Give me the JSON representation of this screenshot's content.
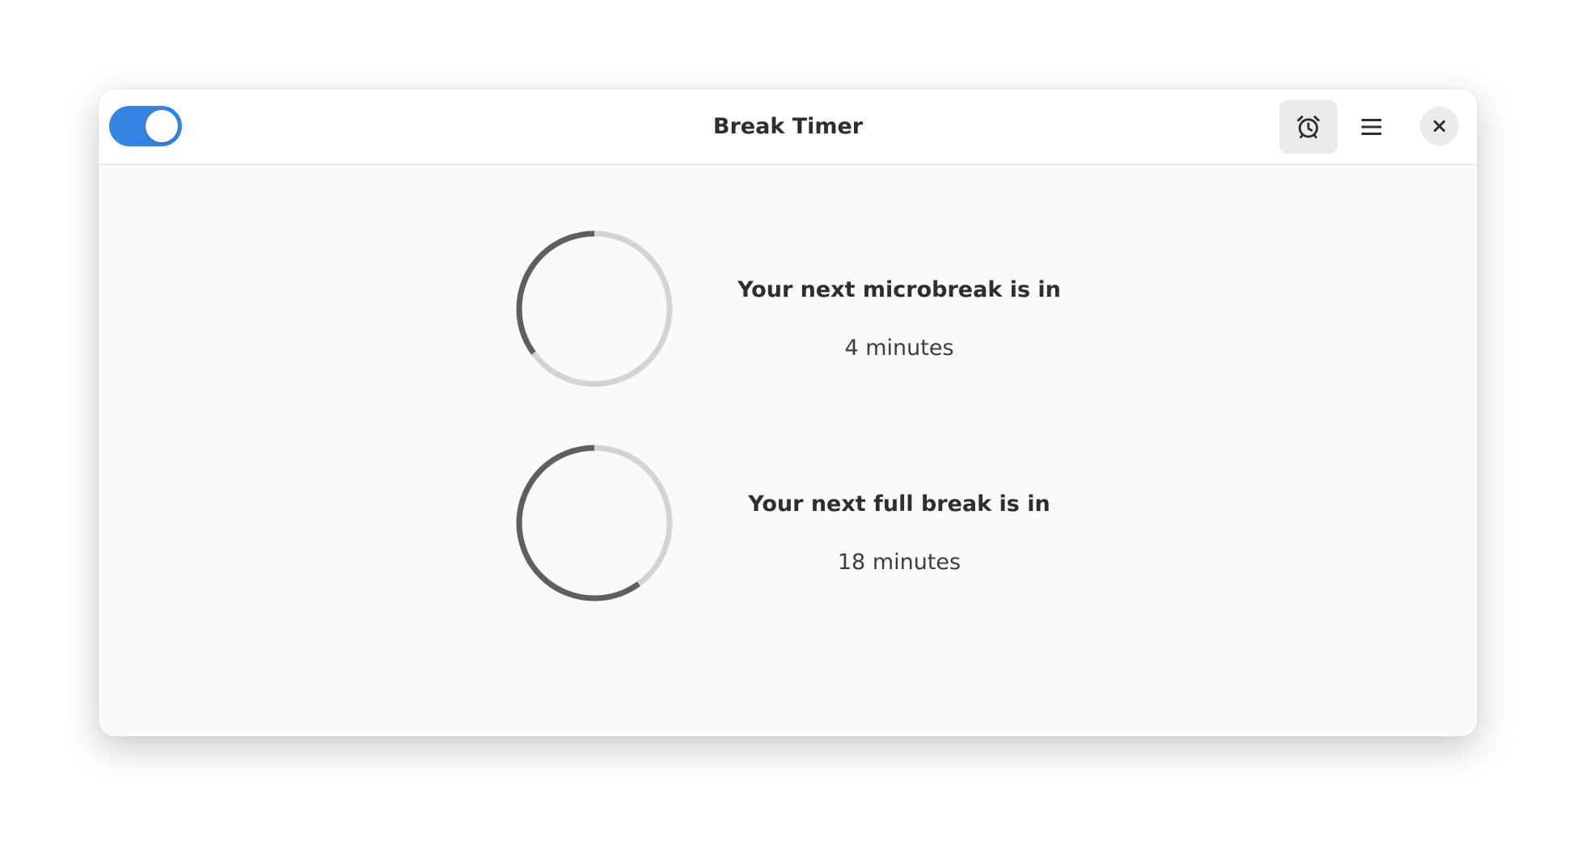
{
  "window": {
    "title": "Break Timer"
  },
  "headerbar": {
    "enable_switch": {
      "on": true,
      "accent_color": "#3584e4"
    },
    "alarm_button_icon": "alarm-clock-icon",
    "menu_button_icon": "hamburger-menu-icon",
    "close_button_icon": "close-icon"
  },
  "timers": [
    {
      "label": "Your next microbreak is in",
      "value": "4 minutes",
      "progress": 0.35
    },
    {
      "label": "Your next full break is in",
      "value": "18 minutes",
      "progress": 0.6
    }
  ]
}
